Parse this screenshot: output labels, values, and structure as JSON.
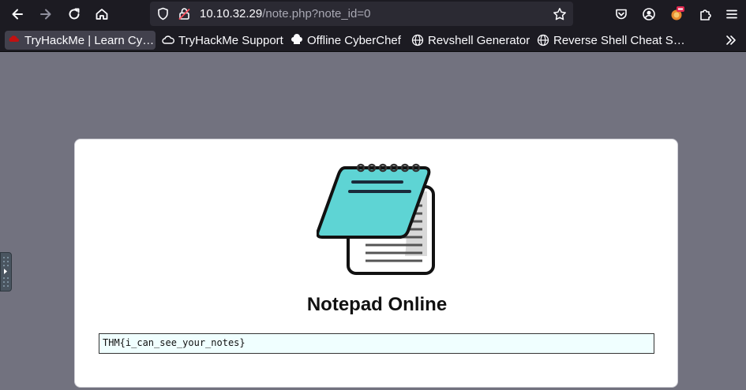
{
  "browser": {
    "url_host": "10.10.32.29",
    "url_path": "/note.php?note_id=0"
  },
  "bookmarks": [
    {
      "label": "TryHackMe | Learn Cy…",
      "icon": "tryhackme-icon"
    },
    {
      "label": "TryHackMe Support",
      "icon": "cloud-icon"
    },
    {
      "label": "Offline CyberChef",
      "icon": "chef-hat-icon"
    },
    {
      "label": "Revshell Generator",
      "icon": "globe-icon"
    },
    {
      "label": "Reverse Shell Cheat S…",
      "icon": "globe-icon"
    }
  ],
  "page": {
    "title": "Notepad Online",
    "note_text": "THM{i_can_see_your_notes}"
  },
  "colors": {
    "page_bg": "#72727f",
    "chrome_bg": "#1c1b22",
    "notepad_accent": "#5ed4d4",
    "note_field_bg": "#f0ffff"
  }
}
